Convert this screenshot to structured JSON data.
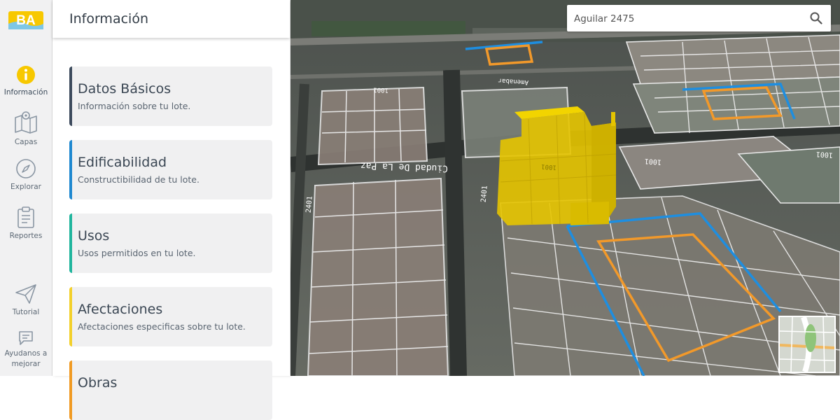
{
  "brand": {
    "logo_text": "BA",
    "accent": "#f7c800"
  },
  "rail": {
    "items": [
      {
        "label": "Información"
      },
      {
        "label": "Capas"
      },
      {
        "label": "Explorar"
      },
      {
        "label": "Reportes"
      },
      {
        "label": "Tutorial"
      },
      {
        "label": "Ayudanos a mejorar"
      }
    ]
  },
  "panel": {
    "title": "Información",
    "cards": [
      {
        "title": "Datos Básicos",
        "subtitle": "Información sobre tu lote.",
        "color": "#3c4a5c"
      },
      {
        "title": "Edificabilidad",
        "subtitle": "Constructibilidad de tu lote.",
        "color": "#1e88d0"
      },
      {
        "title": "Usos",
        "subtitle": "Usos permitidos en tu lote.",
        "color": "#1fb59d"
      },
      {
        "title": "Afectaciones",
        "subtitle": "Afectaciones especificas sobre tu lote.",
        "color": "#f3d02a"
      },
      {
        "title": "Obras",
        "subtitle": "",
        "color": "#f09a22"
      }
    ]
  },
  "search": {
    "value": "Aguilar 2475"
  },
  "map": {
    "street_labels": [
      "Ciudad De La Paz",
      "Amenabar"
    ],
    "block_numbers": [
      "2401",
      "2401",
      "1001",
      "1001",
      "1001",
      "1001"
    ]
  }
}
